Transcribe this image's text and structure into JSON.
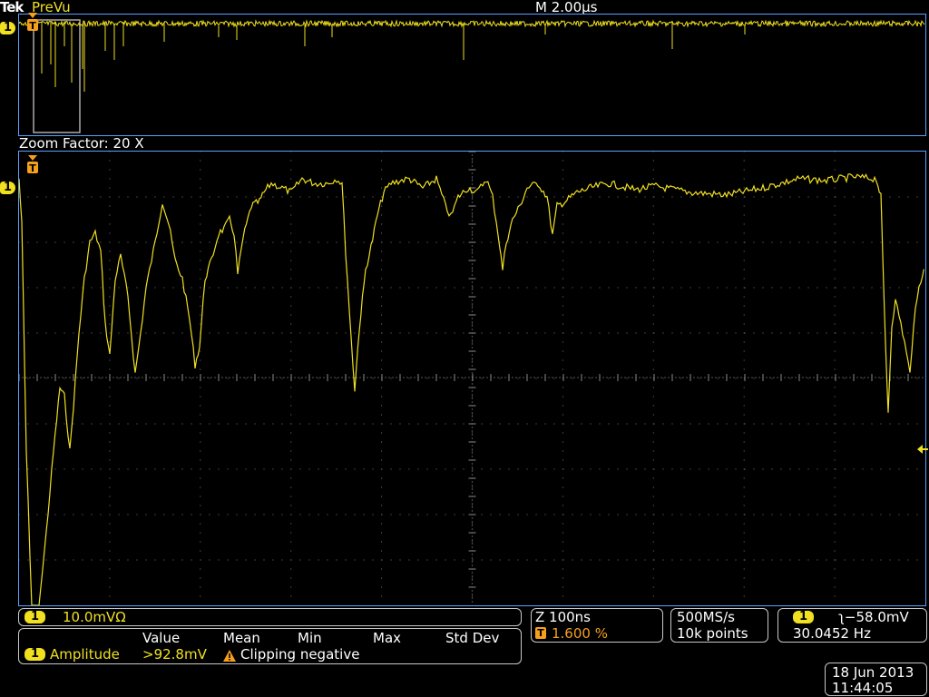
{
  "header": {
    "brand": "Tek",
    "mode": "PreVu",
    "timebase": "M 2.00µs"
  },
  "zoom": {
    "label": "Zoom Factor: 20 X"
  },
  "channel_marker": "1",
  "trigger_marker": "T",
  "channel_bar": {
    "channel": "1",
    "scale": "10.0mVΩ"
  },
  "measurements": {
    "headers": [
      "Value",
      "Mean",
      "Min",
      "Max",
      "Std Dev"
    ],
    "channel": "1",
    "name": "Amplitude",
    "value": ">92.8mV",
    "warning": "Clipping negative"
  },
  "zoom_info": {
    "zoom_time": "Z 100ns",
    "trigger_pos_marker": "T",
    "trigger_pos": "1.600 %"
  },
  "acquisition": {
    "rate": "500MS/s",
    "points": "10k points"
  },
  "trigger_info": {
    "channel": "1",
    "level": "ʅ−58.0mV",
    "frequency": "30.0452 Hz"
  },
  "datetime": {
    "date": "18 Jun  2013",
    "time": "11:44:05"
  },
  "colors": {
    "trace": "#f0e020",
    "panel_border": "#c8c8c8",
    "grid_border": "#5aa0ff",
    "trigger": "#f5a01c"
  }
}
